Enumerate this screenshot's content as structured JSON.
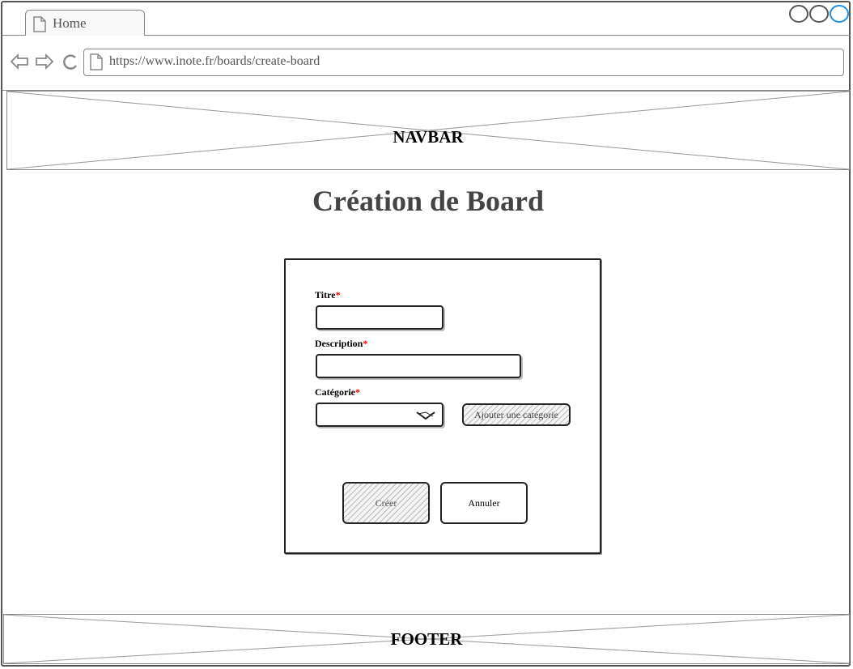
{
  "browser": {
    "tab_label": "Home",
    "url": "https://www.inote.fr/boards/create-board"
  },
  "navbar": {
    "label": "NAVBAR"
  },
  "page": {
    "title": "Création de Board"
  },
  "form": {
    "titre_label": "Titre",
    "description_label": "Description",
    "categorie_label": "Catégorie",
    "required_mark": "*",
    "add_category_label": "Ajouter une catégorie",
    "create_label": "Créer",
    "cancel_label": "Annuler"
  },
  "footer": {
    "label": "FOOTER"
  }
}
